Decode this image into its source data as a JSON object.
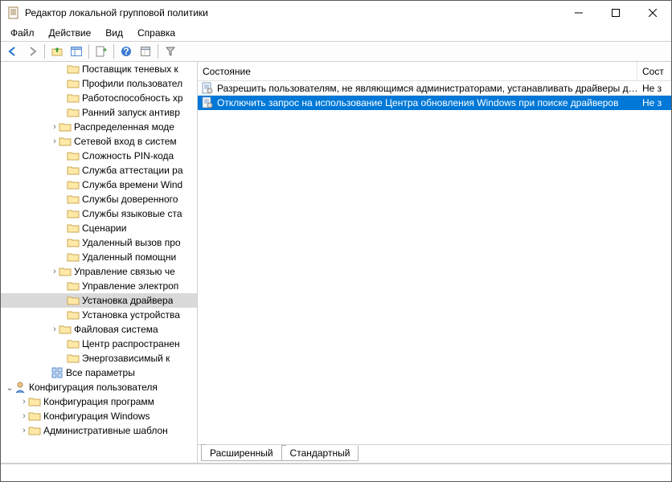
{
  "window": {
    "title": "Редактор локальной групповой политики"
  },
  "menu": {
    "file": "Файл",
    "action": "Действие",
    "view": "Вид",
    "help": "Справка"
  },
  "tree": [
    {
      "indent": 72,
      "twisty": "",
      "icon": "folder",
      "label": "Поставщик теневых к",
      "selected": false
    },
    {
      "indent": 72,
      "twisty": "",
      "icon": "folder",
      "label": "Профили пользовател",
      "selected": false
    },
    {
      "indent": 72,
      "twisty": "",
      "icon": "folder",
      "label": "Работоспособность хр",
      "selected": false
    },
    {
      "indent": 72,
      "twisty": "",
      "icon": "folder",
      "label": "Ранний запуск антивр",
      "selected": false
    },
    {
      "indent": 62,
      "twisty": ">",
      "icon": "folder",
      "label": "Распределенная моде",
      "selected": false
    },
    {
      "indent": 62,
      "twisty": ">",
      "icon": "folder",
      "label": "Сетевой вход в систем",
      "selected": false
    },
    {
      "indent": 72,
      "twisty": "",
      "icon": "folder",
      "label": "Сложность PIN-кода",
      "selected": false
    },
    {
      "indent": 72,
      "twisty": "",
      "icon": "folder",
      "label": "Служба аттестации ра",
      "selected": false
    },
    {
      "indent": 72,
      "twisty": "",
      "icon": "folder",
      "label": "Служба времени Wind",
      "selected": false
    },
    {
      "indent": 72,
      "twisty": "",
      "icon": "folder",
      "label": "Службы доверенного",
      "selected": false
    },
    {
      "indent": 72,
      "twisty": "",
      "icon": "folder",
      "label": "Службы языковые ста",
      "selected": false
    },
    {
      "indent": 72,
      "twisty": "",
      "icon": "folder",
      "label": "Сценарии",
      "selected": false
    },
    {
      "indent": 72,
      "twisty": "",
      "icon": "folder",
      "label": "Удаленный вызов про",
      "selected": false
    },
    {
      "indent": 72,
      "twisty": "",
      "icon": "folder",
      "label": "Удаленный помощни",
      "selected": false
    },
    {
      "indent": 62,
      "twisty": ">",
      "icon": "folder",
      "label": "Управление связью че",
      "selected": false
    },
    {
      "indent": 72,
      "twisty": "",
      "icon": "folder",
      "label": "Управление электроп",
      "selected": false
    },
    {
      "indent": 72,
      "twisty": "",
      "icon": "folder",
      "label": "Установка драйвера",
      "selected": true
    },
    {
      "indent": 72,
      "twisty": "",
      "icon": "folder",
      "label": "Установка устройства",
      "selected": false
    },
    {
      "indent": 62,
      "twisty": ">",
      "icon": "folder",
      "label": "Файловая система",
      "selected": false
    },
    {
      "indent": 72,
      "twisty": "",
      "icon": "folder",
      "label": "Центр распространен",
      "selected": false
    },
    {
      "indent": 72,
      "twisty": "",
      "icon": "folder",
      "label": "Энергозависимый к",
      "selected": false
    },
    {
      "indent": 52,
      "twisty": "",
      "icon": "allparams",
      "label": "Все параметры",
      "selected": false
    },
    {
      "indent": 6,
      "twisty": "v",
      "icon": "userconf",
      "label": "Конфигурация пользователя",
      "selected": false
    },
    {
      "indent": 24,
      "twisty": ">",
      "icon": "folder",
      "label": "Конфигурация программ",
      "selected": false
    },
    {
      "indent": 24,
      "twisty": ">",
      "icon": "folder",
      "label": "Конфигурация Windows",
      "selected": false
    },
    {
      "indent": 24,
      "twisty": ">",
      "icon": "folder",
      "label": "Административные шаблон",
      "selected": false
    }
  ],
  "list": {
    "header_status": "Состояние",
    "header_state": "Сост",
    "rows": [
      {
        "label": "Разрешить пользователям, не являющимся администраторами, устанавливать драйверы д…",
        "state": "Не з",
        "selected": false
      },
      {
        "label": "Отключить запрос на использование Центра обновления Windows при поиске драйверов",
        "state": "Не з",
        "selected": true
      }
    ]
  },
  "tabs": {
    "extended": "Расширенный",
    "standard": "Стандартный"
  }
}
